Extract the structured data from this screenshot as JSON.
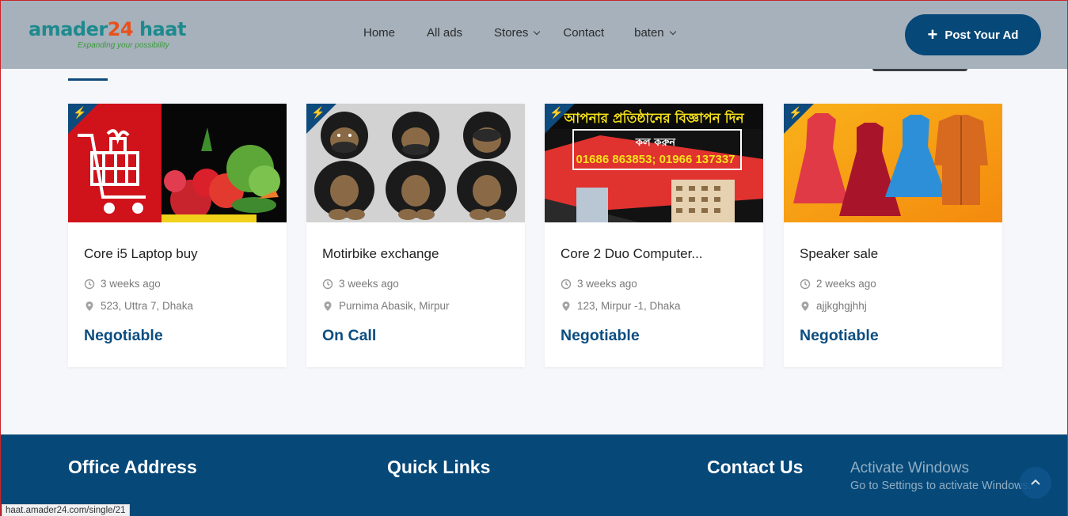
{
  "header": {
    "logo": {
      "part1": "amader",
      "part2": "24",
      "part3": " haat",
      "tagline": "Expanding your possibility"
    },
    "nav": [
      {
        "label": "Home",
        "has_dropdown": false
      },
      {
        "label": "All ads",
        "has_dropdown": false
      },
      {
        "label": "Stores",
        "has_dropdown": true
      },
      {
        "label": "Contact",
        "has_dropdown": false
      },
      {
        "label": "baten",
        "has_dropdown": true
      }
    ],
    "post_button": "Post Your Ad"
  },
  "listings": [
    {
      "title": "Core i5 Laptop buy",
      "time": "3 weeks ago",
      "location": "523, Uttra 7, Dhaka",
      "price": "Negotiable",
      "image": "grocery-cart-vegetables"
    },
    {
      "title": "Motirbike exchange",
      "time": "3 weeks ago",
      "location": "Purnima Abasik, Mirpur",
      "price": "On Call",
      "image": "three-monkeys"
    },
    {
      "title": "Core 2 Duo Computer...",
      "time": "3 weeks ago",
      "location": "123, Mirpur -1, Dhaka",
      "price": "Negotiable",
      "image": "advertisement-banner",
      "banner": {
        "headline": "আপনার প্রতিষ্ঠানের বিজ্ঞাপন দিন",
        "call": "কল করুন",
        "phones": "01686 863853; 01966 137337"
      }
    },
    {
      "title": "Speaker sale",
      "time": "2 weeks ago",
      "location": "ajjkghgjhhj",
      "price": "Negotiable",
      "image": "dresses-and-shirt"
    }
  ],
  "footer": {
    "office_heading": "Office Address",
    "links_heading": "Quick Links",
    "contact_heading": "Contact Us"
  },
  "overlay": {
    "activate_title": "Activate Windows",
    "activate_sub": "Go to Settings to activate Windows."
  },
  "status_url": "haat.amader24.com/single/21",
  "colors": {
    "header_bg": "#a6b1bb",
    "primary": "#064878",
    "price": "#0b4d80",
    "page_bg": "#f6f7fb"
  }
}
